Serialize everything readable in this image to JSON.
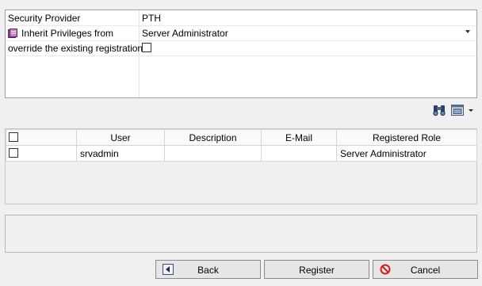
{
  "properties": {
    "security_provider": {
      "label": "Security Provider",
      "value": "PTH"
    },
    "inherit_privileges": {
      "label": "Inherit Privileges from",
      "value": "Server Administrator"
    },
    "override_registration": {
      "label": "override the existing registration",
      "checked": false
    }
  },
  "toolbar": {
    "icons": [
      "binoculars-icon",
      "view-options-icon",
      "chevron-down-icon"
    ]
  },
  "table": {
    "columns": [
      "",
      "User",
      "Description",
      "E-Mail",
      "Registered Role"
    ],
    "rows": [
      {
        "checked": false,
        "user": "srvadmin",
        "description": "",
        "email": "",
        "role": "Server Administrator"
      }
    ]
  },
  "description_panel": {
    "text": ""
  },
  "buttons": {
    "back": "Back",
    "register": "Register",
    "cancel": "Cancel"
  }
}
